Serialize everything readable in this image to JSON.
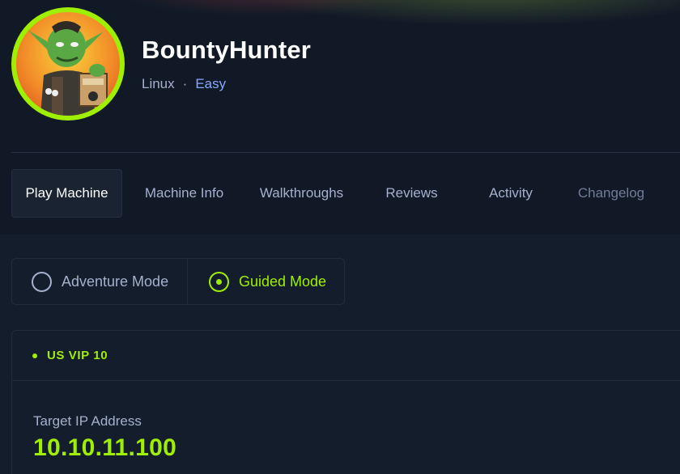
{
  "machine": {
    "name": "BountyHunter",
    "os": "Linux",
    "separator": "·",
    "difficulty": "Easy"
  },
  "tabs": [
    {
      "label": "Play Machine",
      "active": true
    },
    {
      "label": "Machine Info",
      "active": false
    },
    {
      "label": "Walkthroughs",
      "active": false
    },
    {
      "label": "Reviews",
      "active": false
    },
    {
      "label": "Activity",
      "active": false
    },
    {
      "label": "Changelog",
      "active": false
    }
  ],
  "modes": {
    "adventure_label": "Adventure Mode",
    "guided_label": "Guided Mode",
    "selected": "Guided Mode"
  },
  "vpn": {
    "server": "US VIP 10",
    "status_color": "#9fef00"
  },
  "target": {
    "label": "Target IP Address",
    "ip": "10.10.11.100"
  },
  "colors": {
    "accent": "#9fef00",
    "background": "#141d2b",
    "difficulty": "#86a7ff"
  }
}
